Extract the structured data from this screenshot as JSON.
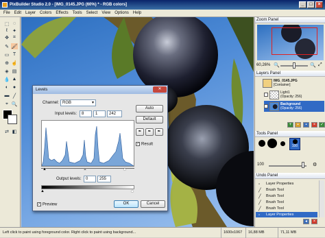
{
  "app": {
    "title": "PixBuilder Studio 2.0 - [IMG_0145.JPG (60%) * - RGB colors]"
  },
  "window_buttons": {
    "min": "_",
    "max": "□",
    "close": "×"
  },
  "menu": [
    "File",
    "Edit",
    "Layer",
    "Colors",
    "Effects",
    "Tools",
    "Select",
    "View",
    "Options",
    "Help"
  ],
  "dialog": {
    "title": "Levels",
    "channel_label": "Channel:",
    "channel_value": "RGB",
    "input_levels_label": "Input levels:",
    "input_low": "8",
    "input_gamma": "1",
    "input_high": "242",
    "output_levels_label": "Output levels:",
    "output_low": "0",
    "output_high": "255",
    "auto": "Auto",
    "default": "Default",
    "result": "Result",
    "preview": "Preview",
    "ok": "OK",
    "cancel": "Cancel"
  },
  "zoom_panel": {
    "title": "Zoom Panel",
    "value": "60,26%"
  },
  "layers_panel": {
    "title": "Layers Panel",
    "layers": [
      {
        "name": "IMG_0145.JPG",
        "sub": "[Container]"
      },
      {
        "name": "Light1",
        "sub": "(Opacity: 256)"
      },
      {
        "name": "Background",
        "sub": "(Opacity: 256)"
      }
    ]
  },
  "tools_panel": {
    "title": "Tools Panel",
    "brush_size": "100",
    "size_field": "100"
  },
  "undo_panel": {
    "title": "Undo Panel",
    "items": [
      "Layer Properties",
      "Brush Tool",
      "Brush Tool",
      "Brush Tool",
      "Brush Tool",
      "Layer Properties"
    ]
  },
  "status": {
    "hint": "Left click to paint using foreground color. Right click to paint using background...",
    "dimensions": "1600x1067",
    "memory": "16,88 MB",
    "zoom": "71,11 MB"
  },
  "colors": {
    "accent": "#316ac5",
    "title_bar": "#0a246a",
    "selection": "#316ac5"
  }
}
